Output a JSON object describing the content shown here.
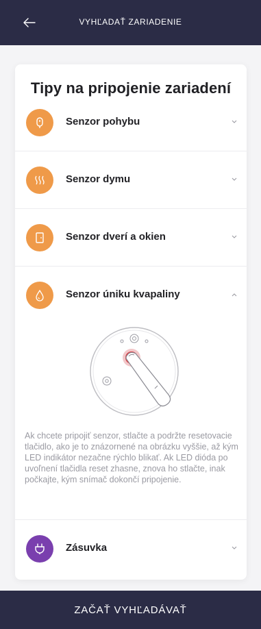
{
  "header": {
    "title": "VYHĽADAŤ ZARIADENIE",
    "back_icon": "arrow-left-icon"
  },
  "card": {
    "title": "Tipy na pripojenie zariadení",
    "items": [
      {
        "label": "Senzor pohybu",
        "icon": "motion-sensor-icon",
        "color": "#ef9a49",
        "expanded": false
      },
      {
        "label": "Senzor dymu",
        "icon": "smoke-waves-icon",
        "color": "#ef9a49",
        "expanded": false
      },
      {
        "label": "Senzor dverí a okien",
        "icon": "door-icon",
        "color": "#ef9a49",
        "expanded": false
      },
      {
        "label": "Senzor úniku kvapaliny",
        "icon": "water-drop-icon",
        "color": "#ef9a49",
        "expanded": true
      },
      {
        "label": "Zásuvka",
        "icon": "plug-icon",
        "color": "#7a3fae",
        "expanded": false
      }
    ],
    "expanded_description": "Ak chcete pripojiť senzor, stlačte a podržte resetovacie tlačidlo, ako je to znázornené na obrázku vyššie, až kým LED indikátor nezačne rýchlo blikať. Ak LED dióda po uvoľnení tlačidla reset zhasne, znova ho stlačte, inak počkajte, kým snímač dokončí pripojenie."
  },
  "footer": {
    "button_label": "ZAČAŤ VYHĽADÁVAŤ"
  },
  "colors": {
    "header_bg": "#2b2c46",
    "accent_orange": "#ef9a49",
    "accent_purple": "#7a3fae",
    "reset_button_red": "#e0323a"
  }
}
